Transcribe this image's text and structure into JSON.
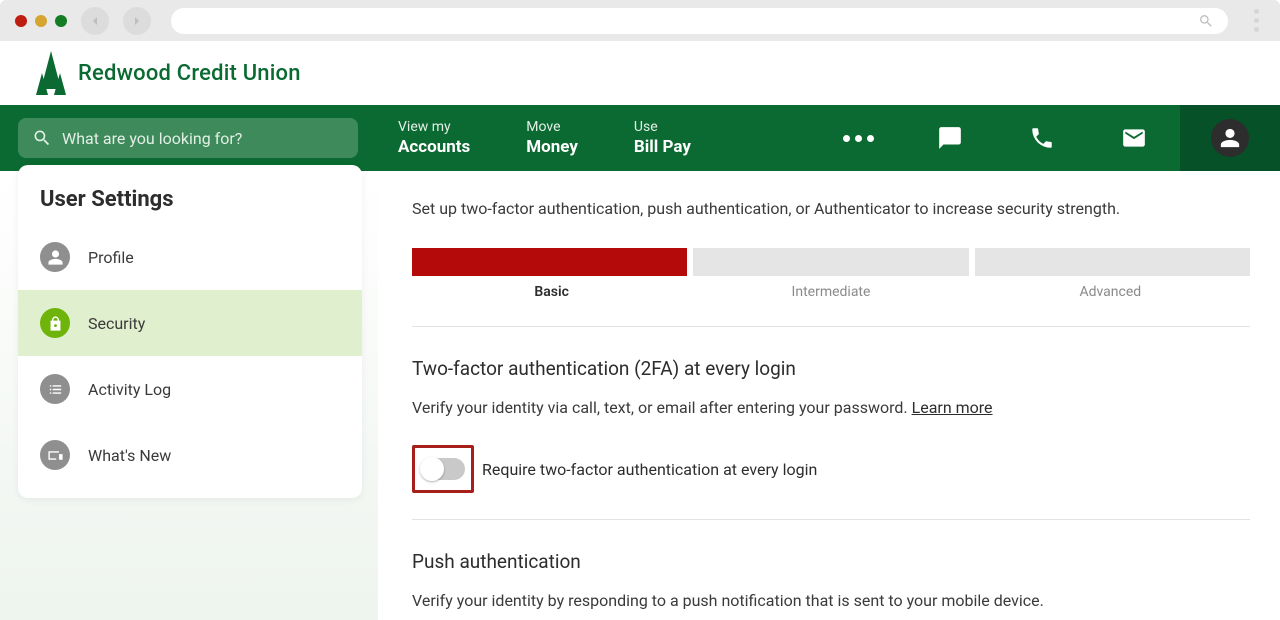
{
  "chrome": {
    "search_icon": "search"
  },
  "brand": {
    "name": "Redwood Credit Union"
  },
  "search": {
    "placeholder": "What are you looking for?"
  },
  "nav": {
    "items": [
      {
        "top": "View my",
        "bottom": "Accounts"
      },
      {
        "top": "Move",
        "bottom": "Money"
      },
      {
        "top": "Use",
        "bottom": "Bill Pay"
      }
    ]
  },
  "sidebar": {
    "title": "User Settings",
    "items": [
      {
        "label": "Profile"
      },
      {
        "label": "Security"
      },
      {
        "label": "Activity Log"
      },
      {
        "label": "What's New"
      }
    ]
  },
  "main": {
    "strength_desc": "Set up two-factor authentication, push authentication, or Authenticator to increase security strength.",
    "levels": {
      "basic": "Basic",
      "intermediate": "Intermediate",
      "advanced": "Advanced"
    },
    "twofa": {
      "heading": "Two-factor authentication (2FA) at every login",
      "desc": "Verify your identity via call, text, or email after entering your password. ",
      "learn_more": "Learn more",
      "toggle_label": "Require two-factor authentication at every login"
    },
    "push": {
      "heading": "Push authentication",
      "desc": "Verify your identity by responding to a push notification that is sent to your mobile device."
    }
  }
}
